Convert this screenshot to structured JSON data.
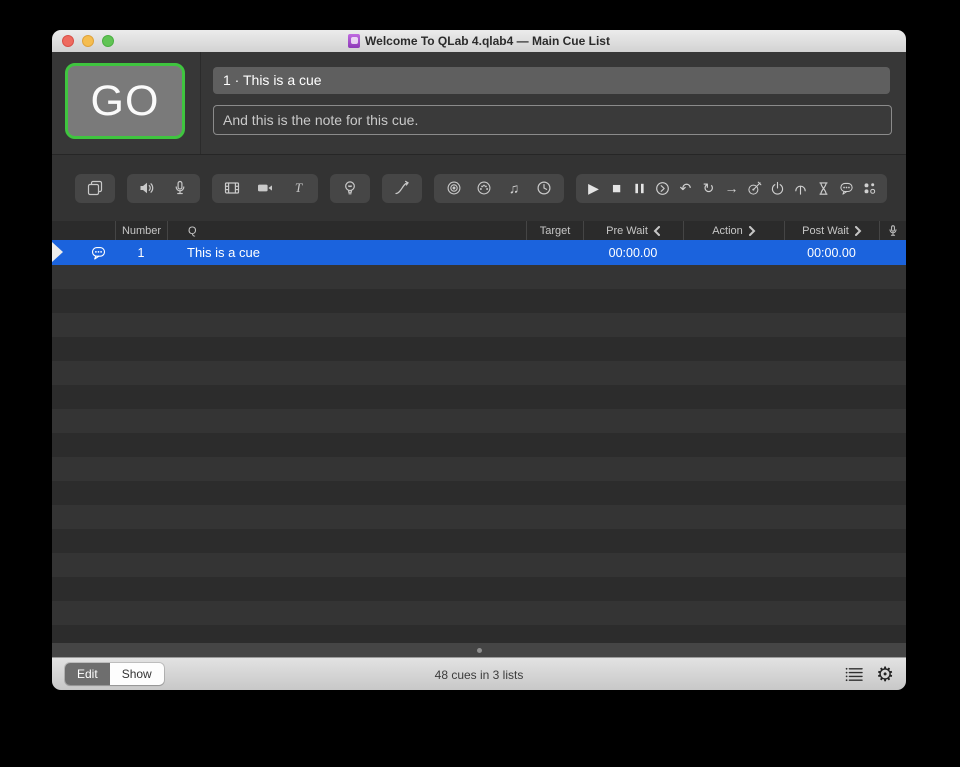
{
  "titlebar": {
    "title": "Welcome To QLab 4.qlab4 — Main Cue List"
  },
  "head": {
    "go_label": "GO",
    "cue_name": "1 · This is a cue",
    "cue_notes": "And this is the note for this cue."
  },
  "toolbar": {
    "buttons": [
      "group",
      "audio",
      "mic",
      "video",
      "camera",
      "text",
      "light",
      "fade",
      "network",
      "midi",
      "midi-file",
      "timecode",
      "start",
      "stop",
      "pause",
      "load",
      "reset",
      "redo",
      "devamp",
      "target",
      "arm",
      "disarm",
      "wait",
      "memo",
      "script"
    ],
    "glyphs": {
      "start": "▶",
      "stop": "■",
      "reset": "↶",
      "redo": "↻",
      "devamp": "→",
      "midi_file": "♫"
    }
  },
  "cue_table": {
    "columns": [
      {
        "label": ""
      },
      {
        "label": "Number"
      },
      {
        "label": "Q"
      },
      {
        "label": "Target"
      },
      {
        "label": "Pre Wait",
        "chevron": "left"
      },
      {
        "label": "Action",
        "chevron": "right"
      },
      {
        "label": "Post Wait",
        "chevron": "right"
      },
      {
        "label": "",
        "icon": "mic"
      }
    ],
    "rows": [
      {
        "icon": "memo",
        "number": "1",
        "q": "This is a cue",
        "target": "",
        "pre_wait": "00:00.00",
        "action": "",
        "post_wait": "00:00.00",
        "selected": true,
        "playhead": true
      }
    ]
  },
  "footer": {
    "edit_label": "Edit",
    "show_label": "Show",
    "status": "48 cues in 3 lists",
    "gear_glyph": "⚙"
  },
  "colors": {
    "selection_blue": "#1b63dd",
    "go_green": "#3fc53f",
    "panel_dark": "#373737",
    "stripe_light": "#343434",
    "stripe_dark": "#2c2c2c",
    "titlebar_light": "#ececec"
  }
}
